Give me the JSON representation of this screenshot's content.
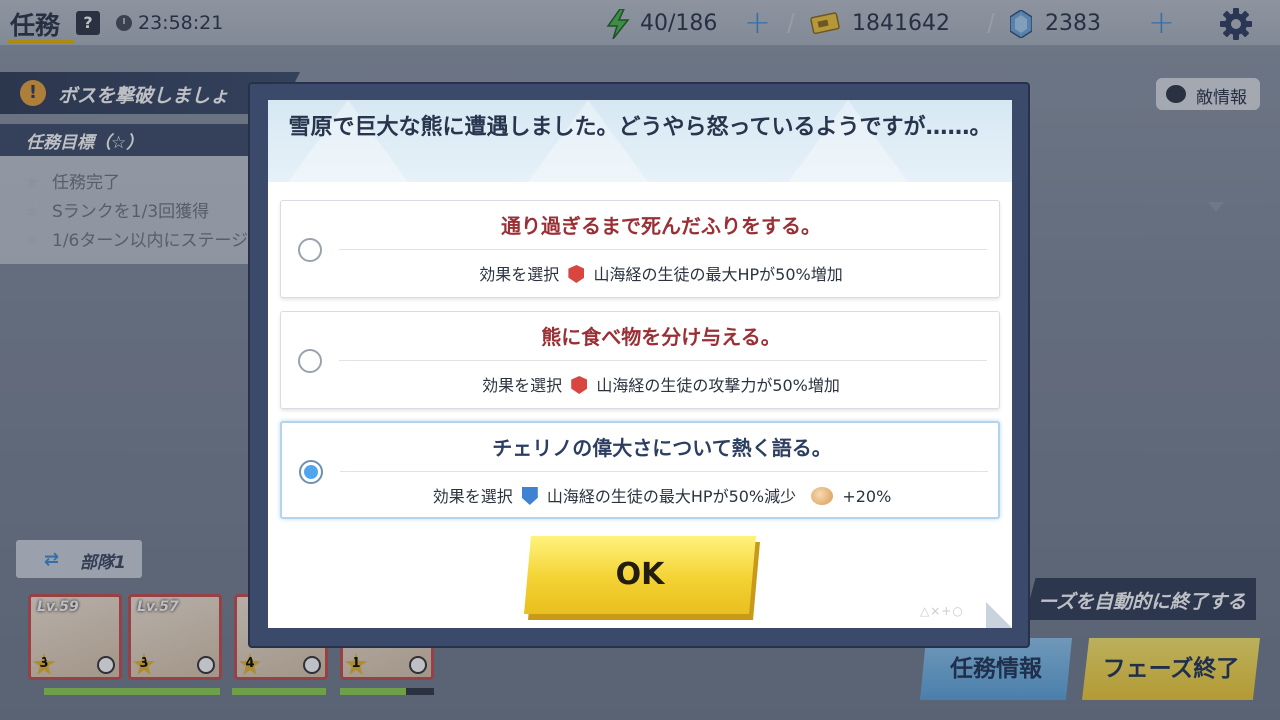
{
  "topbar": {
    "title": "任務",
    "help": "?",
    "timer": "23:58:21",
    "stamina": "40/186",
    "gold": "1841642",
    "gems": "2383"
  },
  "side": {
    "boss_banner": "ボスを撃破しましょ",
    "goal_header": "任務目標（☆）",
    "goals": [
      "任務完了",
      "Sランクを1/3回獲得",
      "1/6ターン以内にステージ"
    ],
    "enemy_info": "敵情報",
    "team": "部隊1",
    "auto_end": "ーズを自動的に終了する",
    "task_info_button": "任務情報",
    "phase_end_button": "フェーズ終了"
  },
  "units": [
    {
      "level": "Lv.59",
      "rank": "3",
      "hp": 1.0
    },
    {
      "level": "Lv.57",
      "rank": "3",
      "hp": 1.0
    },
    {
      "level": "",
      "rank": "4",
      "hp": 1.0
    },
    {
      "level": "",
      "rank": "1",
      "hp": 0.7
    }
  ],
  "dialog": {
    "question": "雪原で巨大な熊に遭遇しました。どうやら怒っているようですが……。",
    "options": [
      {
        "title": "通り過ぎるまで死んだふりをする。",
        "effect_prefix": "効果を選択",
        "effect": "山海経の生徒の最大HPが50%増加",
        "icon": "hp-up-icon",
        "selected": false
      },
      {
        "title": "熊に食べ物を分け与える。",
        "effect_prefix": "効果を選択",
        "effect": "山海経の生徒の攻撃力が50%増加",
        "icon": "attack-up-icon",
        "selected": false
      },
      {
        "title": "チェリノの偉大さについて熱く語る。",
        "effect_prefix": "効果を選択",
        "effect": "山海経の生徒の最大HPが50%減少",
        "bonus": "+20%",
        "icon": "hp-down-icon",
        "selected": true
      }
    ],
    "ok": "OK",
    "deco": "△×+○"
  },
  "colors": {
    "accent_blue": "#3a8bd6",
    "option_title_red": "#9a2f35",
    "ok_yellow": "#f3d233"
  }
}
